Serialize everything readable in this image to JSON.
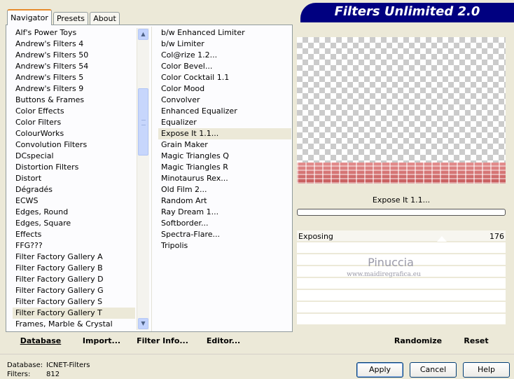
{
  "title": "Filters Unlimited 2.0",
  "tabs": [
    {
      "label": "Navigator",
      "active": true
    },
    {
      "label": "Presets",
      "active": false
    },
    {
      "label": "About",
      "active": false
    }
  ],
  "categories": {
    "items": [
      "Alf's Power Toys",
      "Andrew's Filters 4",
      "Andrew's Filters 50",
      "Andrew's Filters 54",
      "Andrew's Filters 5",
      "Andrew's Filters 9",
      "Buttons & Frames",
      "Color Effects",
      "Color Filters",
      "ColourWorks",
      "Convolution Filters",
      "DCspecial",
      "Distortion Filters",
      "Distort",
      "Dégradés",
      "ECWS",
      "Edges, Round",
      "Edges, Square",
      "Effects",
      "FFG???",
      "Filter Factory Gallery A",
      "Filter Factory Gallery B",
      "Filter Factory Gallery D",
      "Filter Factory Gallery G",
      "Filter Factory Gallery S",
      "Filter Factory Gallery T",
      "Frames, Marble & Crystal"
    ],
    "selected": "Filter Factory Gallery T"
  },
  "filters": {
    "items": [
      "b/w Enhanced Limiter",
      "b/w Limiter",
      "Col@rize 1.2...",
      "Color Bevel...",
      "Color Cocktail 1.1",
      "Color Mood",
      "Convolver",
      "Enhanced Equalizer",
      "Equalizer",
      "Expose It 1.1...",
      "Grain Maker",
      "Magic Triangles Q",
      "Magic Triangles R",
      "Minotaurus Rex...",
      "Old Film 2...",
      "Random Art",
      "Ray Dream 1...",
      "Softborder...",
      "Spectra-Flare...",
      "Tripolis"
    ],
    "selected": "Expose It 1.1..."
  },
  "preview": {
    "filter_name": "Expose It 1.1...",
    "progress_percent": 0
  },
  "parameters": [
    {
      "name": "Exposing",
      "value": "176"
    }
  ],
  "watermark": {
    "name": "Pinuccia",
    "site": "www.maidiregrafica.eu"
  },
  "actions": {
    "database": "Database",
    "import": "Import...",
    "filter_info": "Filter Info...",
    "editor": "Editor...",
    "randomize": "Randomize",
    "reset": "Reset"
  },
  "status": {
    "database_label": "Database:",
    "database_value": "ICNET-Filters",
    "filters_label": "Filters:",
    "filters_value": "812"
  },
  "buttons": {
    "apply": "Apply",
    "cancel": "Cancel",
    "help": "Help"
  },
  "colors": {
    "window_bg": "#ECE9D8",
    "banner": "#000080",
    "tab_accent": "#E68B2C"
  }
}
